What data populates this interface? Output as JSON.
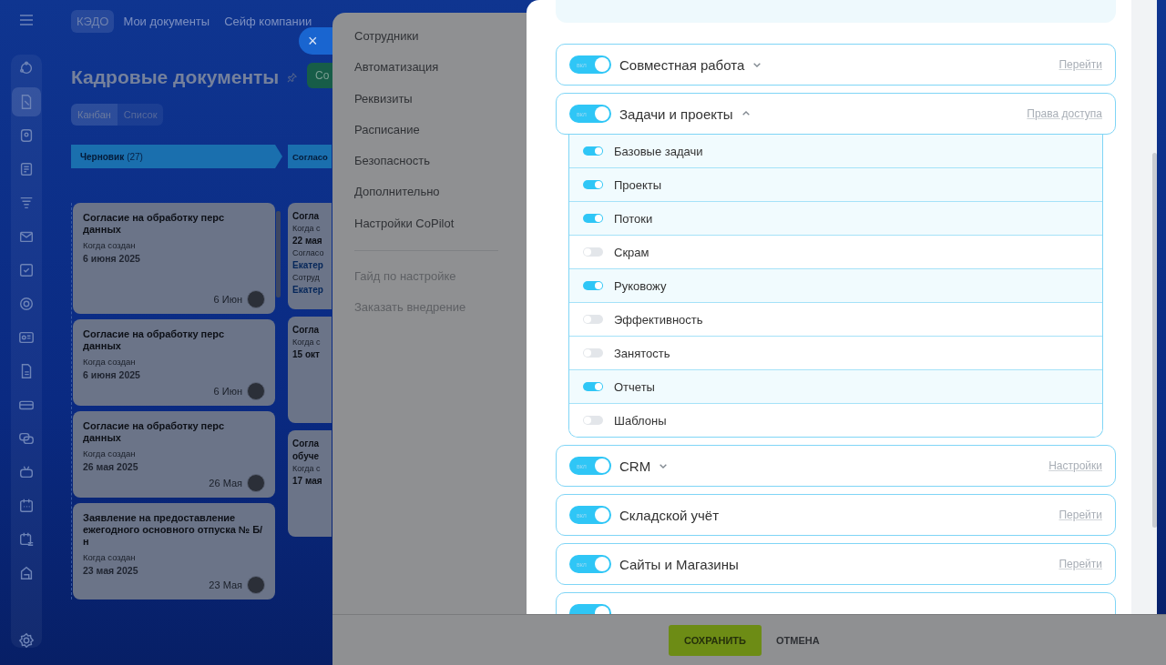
{
  "app": {
    "nav_tabs": [
      {
        "label": "КЭДО",
        "selected": true
      },
      {
        "label": "Мои документы",
        "selected": false
      },
      {
        "label": "Сейф компании",
        "selected": false
      }
    ],
    "title": "Кадровые документы",
    "create_button": "Со",
    "close_button": "×",
    "view_tabs": [
      {
        "label": "Канбан",
        "selected": true
      },
      {
        "label": "Список",
        "selected": false
      }
    ],
    "columns": [
      {
        "title": "Черновик",
        "count": "(27)",
        "cards": [
          {
            "title": "Согласие на обработку перс данных",
            "label": "Когда создан",
            "date": "6 июня 2025",
            "footer_date": "6 Июн"
          },
          {
            "title": "Согласие на обработку перс данных",
            "label": "Когда создан",
            "date": "6 июня 2025",
            "footer_date": "6 Июн"
          },
          {
            "title": "Согласие на обработку перс данных",
            "label": "Когда создан",
            "date": "26 мая 2025",
            "footer_date": "26 Мая"
          },
          {
            "title": "Заявление на предоставление ежегодного основного отпуска № Б/н",
            "label": "Когда создан",
            "date": "23 мая 2025",
            "footer_date": "23 Мая"
          }
        ]
      },
      {
        "title": "Согласо",
        "cards": [
          {
            "lines": [
              {
                "kind": "title",
                "text": "Согла"
              },
              {
                "kind": "label",
                "text": "Когда с"
              },
              {
                "kind": "value",
                "text": "22 мая"
              },
              {
                "kind": "label",
                "text": "Согласо"
              },
              {
                "kind": "link",
                "text": "Екатер"
              },
              {
                "kind": "label",
                "text": "Сотруд"
              },
              {
                "kind": "link",
                "text": "Екатер"
              }
            ]
          },
          {
            "lines": [
              {
                "kind": "title",
                "text": "Согла"
              },
              {
                "kind": "label",
                "text": "Когда с"
              },
              {
                "kind": "value",
                "text": "15 окт"
              }
            ]
          },
          {
            "lines": [
              {
                "kind": "title",
                "text": "Согла"
              },
              {
                "kind": "title",
                "text": "обуче"
              },
              {
                "kind": "label",
                "text": "Когда с"
              },
              {
                "kind": "value",
                "text": "17 мая"
              }
            ]
          }
        ]
      }
    ]
  },
  "settings": {
    "menu": [
      "Сотрудники",
      "Автоматизация",
      "Реквизиты",
      "Расписание",
      "Безопасность",
      "Дополнительно",
      "Настройки CoPilot"
    ],
    "secondary_menu": [
      "Гайд по настройке",
      "Заказать внедрение"
    ],
    "modules": [
      {
        "name": "Совместная работа",
        "on": true,
        "state_label": "вкл",
        "expanded": false,
        "link": "Перейти"
      },
      {
        "name": "Задачи и проекты",
        "on": true,
        "state_label": "вкл",
        "expanded": true,
        "link": "Права доступа",
        "children": [
          {
            "name": "Базовые задачи",
            "on": true
          },
          {
            "name": "Проекты",
            "on": true
          },
          {
            "name": "Потоки",
            "on": true
          },
          {
            "name": "Скрам",
            "on": false
          },
          {
            "name": "Руковожу",
            "on": true
          },
          {
            "name": "Эффективность",
            "on": false
          },
          {
            "name": "Занятость",
            "on": false
          },
          {
            "name": "Отчеты",
            "on": true
          },
          {
            "name": "Шаблоны",
            "on": false
          }
        ]
      },
      {
        "name": "CRM",
        "on": true,
        "state_label": "вкл",
        "expanded": false,
        "link": "Настройки"
      },
      {
        "name": "Складской учёт",
        "on": true,
        "state_label": "вкл",
        "link": "Перейти"
      },
      {
        "name": "Сайты и Магазины",
        "on": true,
        "state_label": "вкл",
        "link": "Перейти"
      },
      {
        "on": true
      }
    ],
    "buttons": {
      "save": "СОХРАНИТЬ",
      "cancel": "ОТМЕНА"
    }
  }
}
